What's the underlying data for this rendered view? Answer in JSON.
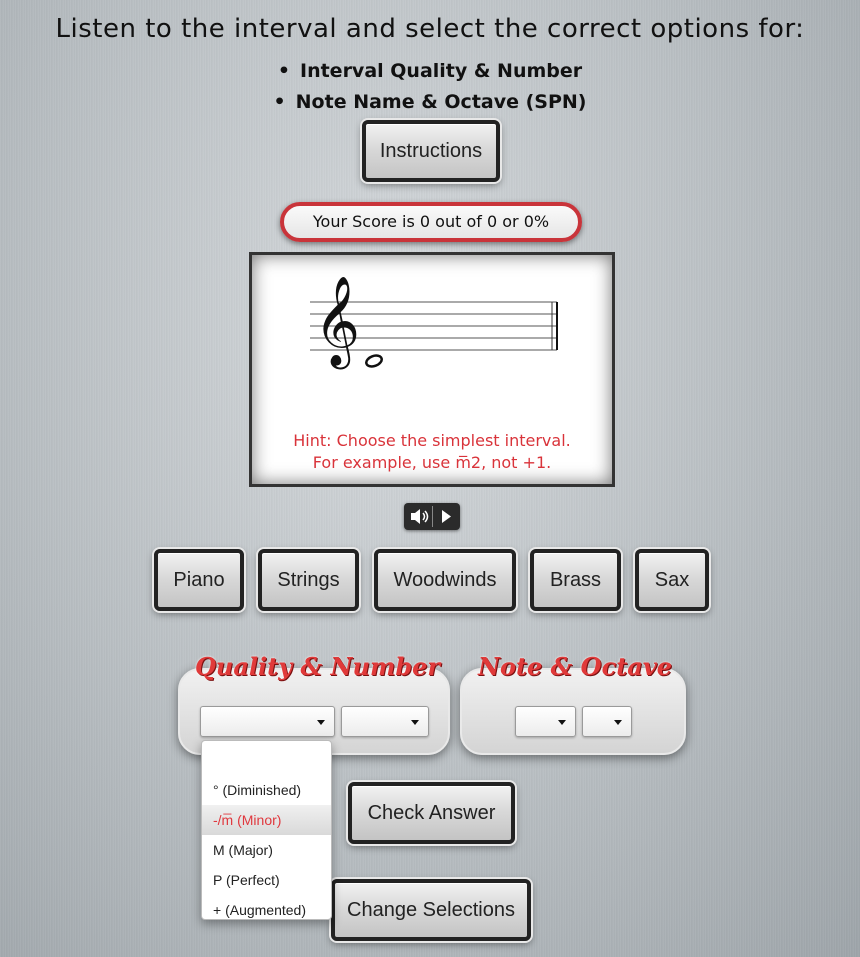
{
  "header": {
    "title": "Listen to the interval and select the correct options for:",
    "bullets": [
      "Interval Quality & Number",
      "Note Name & Octave (SPN)"
    ]
  },
  "instructions_button": "Instructions",
  "score": "Your Score is 0 out of 0 or 0%",
  "staff": {
    "hint_line1": "Hint: Choose the simplest interval.",
    "hint_line2": "For example, use m̅2, not +1."
  },
  "audio": {
    "mute_icon": "speaker-icon",
    "play_icon": "play-icon"
  },
  "instruments": [
    "Piano",
    "Strings",
    "Woodwinds",
    "Brass",
    "Sax"
  ],
  "quality_group": {
    "title": "Quality & Number",
    "quality_value": "",
    "number_value": ""
  },
  "note_group": {
    "title": "Note & Octave",
    "note_value": "",
    "octave_value": ""
  },
  "quality_options": [
    "",
    "° (Diminished)",
    "-/m̅ (Minor)",
    "M (Major)",
    "P (Perfect)",
    "+ (Augmented)"
  ],
  "highlighted_option": "-/m̅ (Minor)",
  "check_button": "Check Answer",
  "change_button": "Change Selections",
  "colors": {
    "accent_red": "#d9333a",
    "button_border": "#222222"
  }
}
